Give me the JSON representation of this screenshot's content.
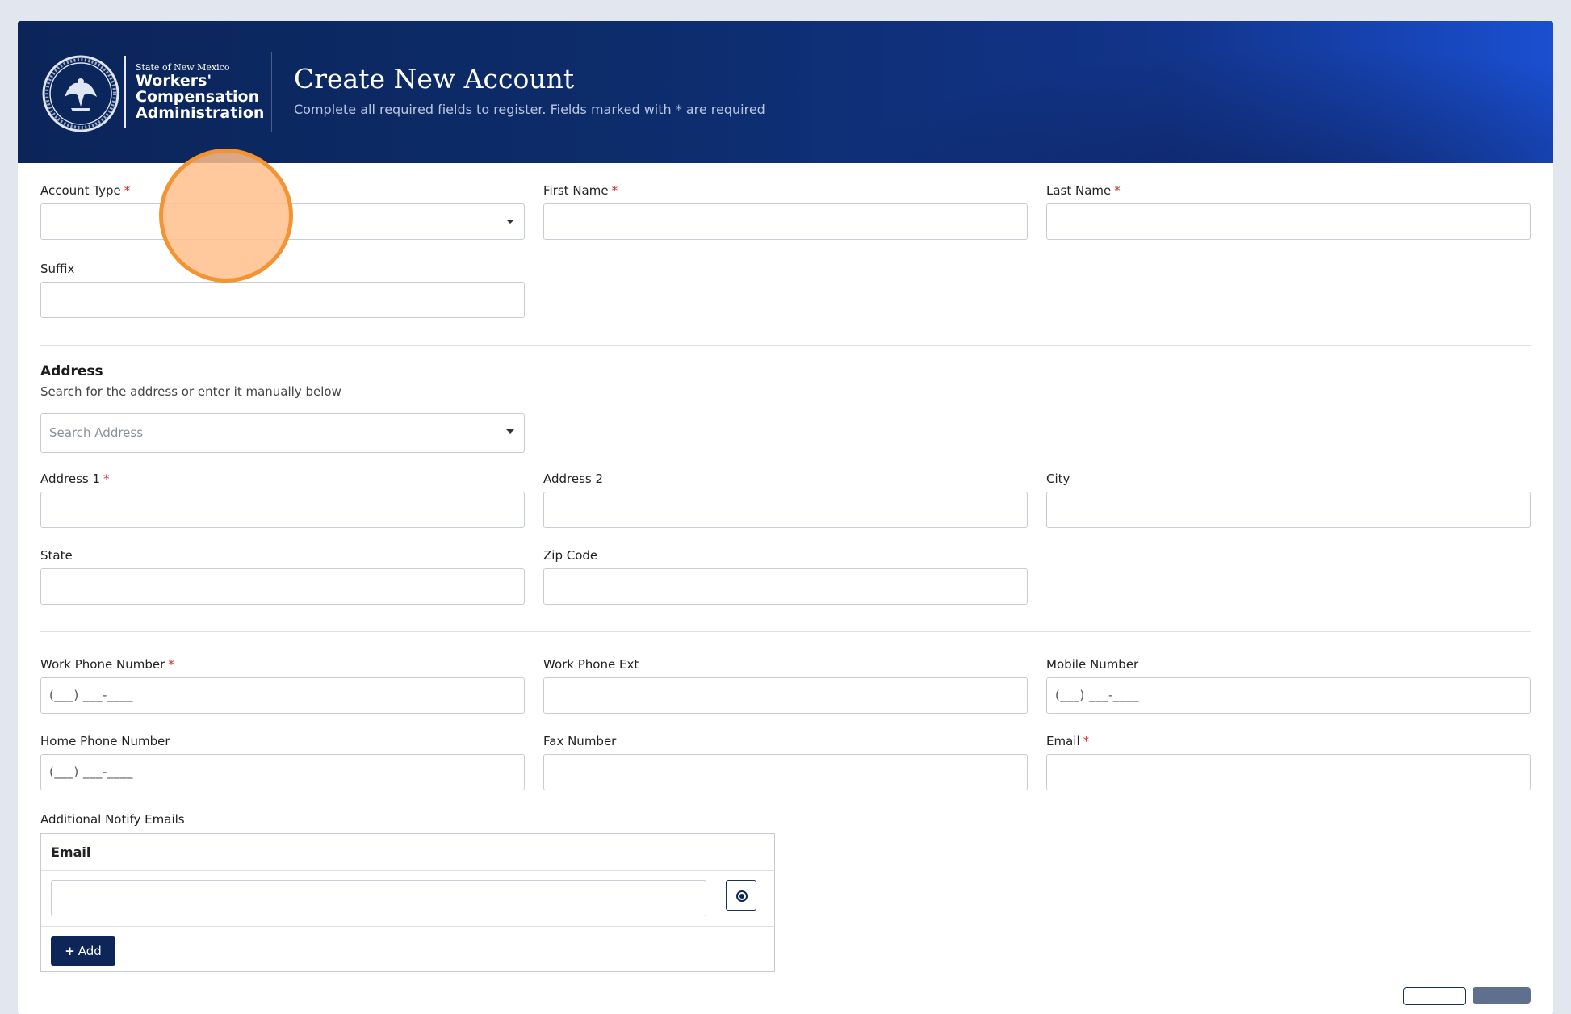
{
  "header": {
    "logo": {
      "state_line": "State of New Mexico",
      "agency_lines": [
        "Workers'",
        "Compensation",
        "Administration"
      ],
      "seal_icon": "state-seal-icon"
    },
    "title": "Create New Account",
    "subtitle": "Complete all required fields to register. Fields marked with * are required"
  },
  "required_marker": "*",
  "fields": {
    "account_type": {
      "label": "Account Type",
      "value": "",
      "required": true
    },
    "first_name": {
      "label": "First Name",
      "value": "",
      "required": true
    },
    "last_name": {
      "label": "Last Name",
      "value": "",
      "required": true
    },
    "suffix": {
      "label": "Suffix",
      "value": ""
    }
  },
  "address": {
    "title": "Address",
    "description": "Search for the address or enter it manually below",
    "search_placeholder": "Search Address",
    "address1": {
      "label": "Address 1",
      "value": "",
      "required": true
    },
    "address2": {
      "label": "Address 2",
      "value": ""
    },
    "city": {
      "label": "City",
      "value": ""
    },
    "state": {
      "label": "State",
      "value": ""
    },
    "zip": {
      "label": "Zip Code",
      "value": ""
    }
  },
  "phones": {
    "work_phone": {
      "label": "Work Phone Number",
      "mask": "(___) ___-____",
      "required": true
    },
    "work_ext": {
      "label": "Work Phone Ext",
      "value": ""
    },
    "mobile": {
      "label": "Mobile Number",
      "mask": "(___) ___-____"
    },
    "home_phone": {
      "label": "Home Phone Number",
      "mask": "(___) ___-____"
    },
    "fax": {
      "label": "Fax Number",
      "value": ""
    },
    "email": {
      "label": "Email",
      "value": "",
      "required": true
    }
  },
  "notify": {
    "label": "Additional Notify Emails",
    "column_header": "Email",
    "rows": [
      {
        "email": ""
      }
    ],
    "remove_icon": "radio-remove-icon",
    "add_icon": "plus-icon",
    "add_label": "Add"
  },
  "colors": {
    "header_dark": "#0b2559",
    "header_bright": "#1a4fd0",
    "required": "#d62828",
    "primary_button": "#0d2657",
    "cursor_fill": "#ffbe8c",
    "cursor_ring": "#f39332"
  }
}
